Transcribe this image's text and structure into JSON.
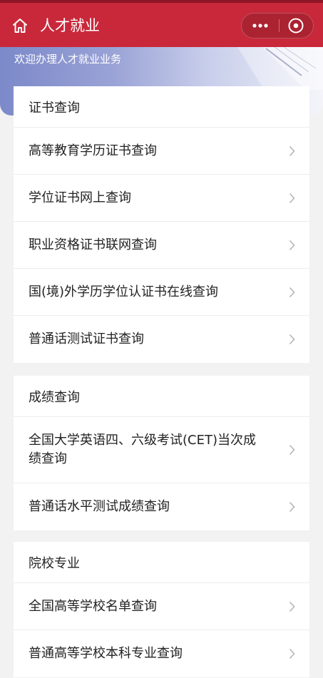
{
  "header": {
    "title": "人才就业",
    "home_icon": "home-icon",
    "more_icon": "more-icon",
    "close_icon": "close-target-icon",
    "color": "#c8283a"
  },
  "banner": {
    "text": "欢迎办理人才就业业务"
  },
  "sections": [
    {
      "title": "证书查询",
      "items": [
        "高等教育学历证书查询",
        "学位证书网上查询",
        "职业资格证书联网查询",
        "国(境)外学历学位认证书在线查询",
        "普通话测试证书查询"
      ]
    },
    {
      "title": "成绩查询",
      "items": [
        "全国大学英语四、六级考试(CET)当次成绩查询",
        "普通话水平测试成绩查询"
      ]
    },
    {
      "title": "院校专业",
      "items": [
        "全国高等学校名单查询",
        "普通高等学校本科专业查询"
      ]
    }
  ]
}
